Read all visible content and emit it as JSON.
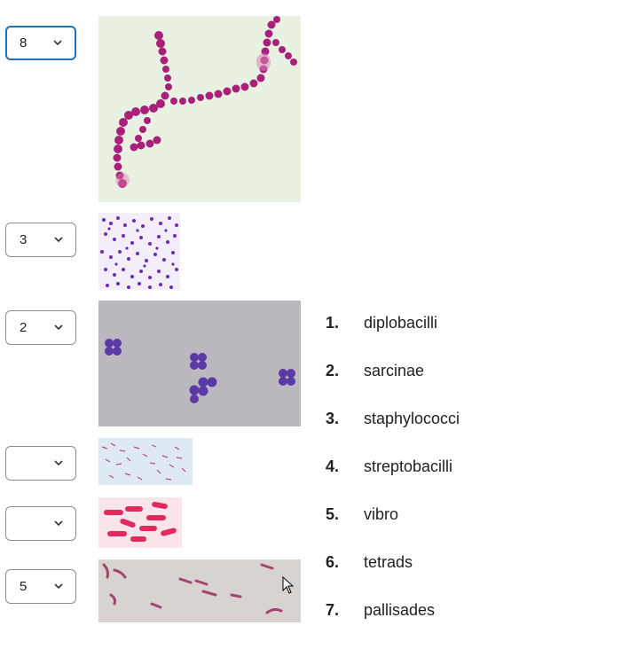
{
  "questions": [
    {
      "selected": "8",
      "image": "bacteria-chain-image"
    },
    {
      "selected": "3",
      "image": "bacteria-cluster-image"
    },
    {
      "selected": "2",
      "image": "bacteria-tetrad-image"
    },
    {
      "selected": "",
      "image": "bacteria-scattered-image"
    },
    {
      "selected": "",
      "image": "bacteria-pink-rods-image"
    },
    {
      "selected": "5",
      "image": "bacteria-curved-rods-image"
    }
  ],
  "answers": [
    {
      "num": "1.",
      "label": "diplobacilli"
    },
    {
      "num": "2.",
      "label": "sarcinae"
    },
    {
      "num": "3.",
      "label": "staphylococci"
    },
    {
      "num": "4.",
      "label": "streptobacilli"
    },
    {
      "num": "5.",
      "label": "vibro"
    },
    {
      "num": "6.",
      "label": "tetrads"
    },
    {
      "num": "7.",
      "label": "pallisades"
    }
  ],
  "colors": {
    "focus_border": "#1e72b8",
    "border": "#8a8c8e"
  },
  "icons": {
    "dropdown": "chevron-down-icon",
    "cursor": "mouse-pointer-icon"
  }
}
